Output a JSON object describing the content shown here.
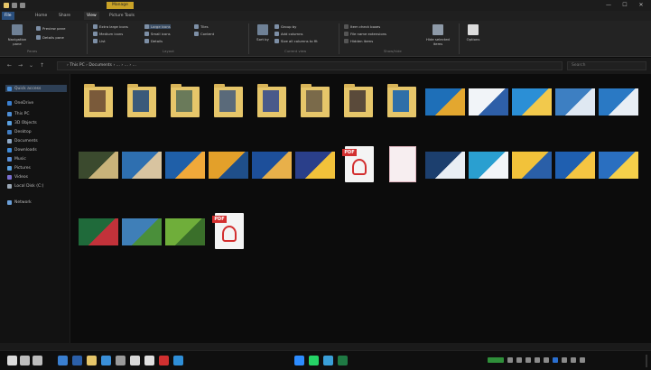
{
  "titlebar": {
    "context_tab": "Manage",
    "title": "",
    "minimize": "—",
    "maximize": "☐",
    "close": "✕",
    "colors": {
      "accent": "#c9a227"
    }
  },
  "ribbon_tabs": [
    {
      "label": "File"
    },
    {
      "label": "Home"
    },
    {
      "label": "Share"
    },
    {
      "label": "View"
    },
    {
      "label": "Picture Tools"
    }
  ],
  "ribbon": {
    "groups": [
      {
        "label": "Panes"
      },
      {
        "label": "Layout"
      },
      {
        "label": "Current view"
      },
      {
        "label": "Show/hide"
      }
    ],
    "buttons": [
      {
        "label": "Navigation pane"
      },
      {
        "label": "Preview pane"
      },
      {
        "label": "Details pane"
      },
      {
        "label": "Extra large icons"
      },
      {
        "label": "Large icons"
      },
      {
        "label": "Medium icons"
      },
      {
        "label": "Small icons"
      },
      {
        "label": "List"
      },
      {
        "label": "Details"
      },
      {
        "label": "Tiles"
      },
      {
        "label": "Content"
      },
      {
        "label": "Sort by"
      },
      {
        "label": "Group by"
      },
      {
        "label": "Add columns"
      },
      {
        "label": "Size all columns to fit"
      },
      {
        "label": "Item check boxes"
      },
      {
        "label": "File name extensions"
      },
      {
        "label": "Hidden items"
      },
      {
        "label": "Hide selected items"
      },
      {
        "label": "Options"
      }
    ]
  },
  "addressbar": {
    "path": "›  This PC  ›  Documents  ›  ...  ›  ...  ›  ...",
    "search_placeholder": "Search"
  },
  "navpane": {
    "items": [
      {
        "label": "Quick access",
        "selected": true,
        "icon": "star-icon",
        "color": "#4a8fd8"
      },
      {
        "label": "OneDrive",
        "icon": "cloud-icon",
        "color": "#3a7fd0"
      },
      {
        "label": "This PC",
        "icon": "pc-icon",
        "color": "#4d8ed6"
      },
      {
        "label": "3D Objects",
        "icon": "cube-icon",
        "color": "#5aa0e0"
      },
      {
        "label": "Desktop",
        "icon": "desktop-icon",
        "color": "#3f7cc2"
      },
      {
        "label": "Documents",
        "icon": "document-icon",
        "color": "#8fa9c7"
      },
      {
        "label": "Downloads",
        "icon": "download-icon",
        "color": "#3f8ad8"
      },
      {
        "label": "Music",
        "icon": "music-icon",
        "color": "#5a8fd8"
      },
      {
        "label": "Pictures",
        "icon": "picture-icon",
        "color": "#5aa0e0"
      },
      {
        "label": "Videos",
        "icon": "video-icon",
        "color": "#7a6fd0"
      },
      {
        "label": "Local Disk (C:)",
        "icon": "drive-icon",
        "color": "#9aa7b5"
      },
      {
        "label": "Network",
        "icon": "network-icon",
        "color": "#6b9fd8"
      }
    ]
  },
  "files": [
    {
      "name": "",
      "kind": "folder",
      "pic": "#7a5a3a"
    },
    {
      "name": "",
      "kind": "folder",
      "pic": "#3a5a7a"
    },
    {
      "name": "",
      "kind": "folder",
      "pic": "#6a7a5a"
    },
    {
      "name": "",
      "kind": "folder",
      "pic": "#5a6a7a"
    },
    {
      "name": "",
      "kind": "folder",
      "pic": "#4a5a8a"
    },
    {
      "name": "",
      "kind": "folder",
      "pic": "#7a6a4a"
    },
    {
      "name": "",
      "kind": "folder",
      "pic": "#5a4a3a"
    },
    {
      "name": "",
      "kind": "folder",
      "pic": "#2f6fa8"
    },
    {
      "name": "",
      "kind": "image",
      "c1": "#1e6fb8",
      "c2": "#e3a72f"
    },
    {
      "name": "",
      "kind": "image",
      "c1": "#f1f4f8",
      "c2": "#2e5fa8"
    },
    {
      "name": "",
      "kind": "image",
      "c1": "#2b8fd6",
      "c2": "#f2c94c"
    },
    {
      "name": "",
      "kind": "image",
      "c1": "#3d7fc2",
      "c2": "#dfe8f2"
    },
    {
      "name": "",
      "kind": "image",
      "c1": "#2a79c4",
      "c2": "#e8eef5"
    },
    {
      "name": "",
      "kind": "image",
      "c1": "#3b4a2e",
      "c2": "#c9b37a"
    },
    {
      "name": "",
      "kind": "image",
      "c1": "#2e6fb0",
      "c2": "#d8c4a0"
    },
    {
      "name": "",
      "kind": "image",
      "c1": "#1f5fa8",
      "c2": "#f0a93a"
    },
    {
      "name": "",
      "kind": "image",
      "c1": "#e3a02a",
      "c2": "#1f4f8a"
    },
    {
      "name": "",
      "kind": "image",
      "c1": "#1d4f9a",
      "c2": "#e8b04a"
    },
    {
      "name": "",
      "kind": "image",
      "c1": "#2a3f8a",
      "c2": "#f2c23a"
    },
    {
      "name": "",
      "kind": "pdf"
    },
    {
      "name": "",
      "kind": "doc"
    },
    {
      "name": "",
      "kind": "image",
      "c1": "#1c3f6e",
      "c2": "#e9eef4"
    },
    {
      "name": "",
      "kind": "image",
      "c1": "#2a9fd0",
      "c2": "#f2f5f8"
    },
    {
      "name": "",
      "kind": "image",
      "c1": "#f2c23a",
      "c2": "#2a5fa8"
    },
    {
      "name": "",
      "kind": "image",
      "c1": "#1f5fb0",
      "c2": "#f5c542"
    },
    {
      "name": "",
      "kind": "image",
      "c1": "#2a6fc0",
      "c2": "#f5d04a"
    },
    {
      "name": "",
      "kind": "image",
      "c1": "#1f6a3a",
      "c2": "#c2323a"
    },
    {
      "name": "",
      "kind": "image",
      "c1": "#3f7fb8",
      "c2": "#4a8f3a"
    },
    {
      "name": "",
      "kind": "image",
      "c1": "#6fae3a",
      "c2": "#3a6f2a"
    },
    {
      "name": "",
      "kind": "pdf"
    }
  ],
  "statusbar": {
    "text": ""
  },
  "taskbar": {
    "icons": [
      {
        "name": "start-icon",
        "color": "#dcdcdc"
      },
      {
        "name": "search-icon",
        "color": "#bdbdbd"
      },
      {
        "name": "task-view-icon",
        "color": "#bdbdbd"
      },
      {
        "name": "store-icon",
        "color": "#3a7fd0"
      },
      {
        "name": "word-icon",
        "color": "#2b5fa8"
      },
      {
        "name": "explorer-icon",
        "color": "#e6c66a"
      },
      {
        "name": "mail-icon",
        "color": "#3a8fd8"
      },
      {
        "name": "settings-icon",
        "color": "#9a9a9a"
      },
      {
        "name": "photos-icon",
        "color": "#d8d8d8"
      },
      {
        "name": "chrome-icon",
        "color": "#e0e0e0"
      },
      {
        "name": "media-icon",
        "color": "#d03030"
      },
      {
        "name": "edge-icon",
        "color": "#2f8fd8"
      },
      {
        "name": "zoom-icon",
        "color": "#2d8cff"
      },
      {
        "name": "whatsapp-icon",
        "color": "#25d366"
      },
      {
        "name": "maps-icon",
        "color": "#3a9fd8"
      },
      {
        "name": "excel-icon",
        "color": "#1f7a44"
      }
    ],
    "clock_time": "",
    "clock_date": ""
  }
}
